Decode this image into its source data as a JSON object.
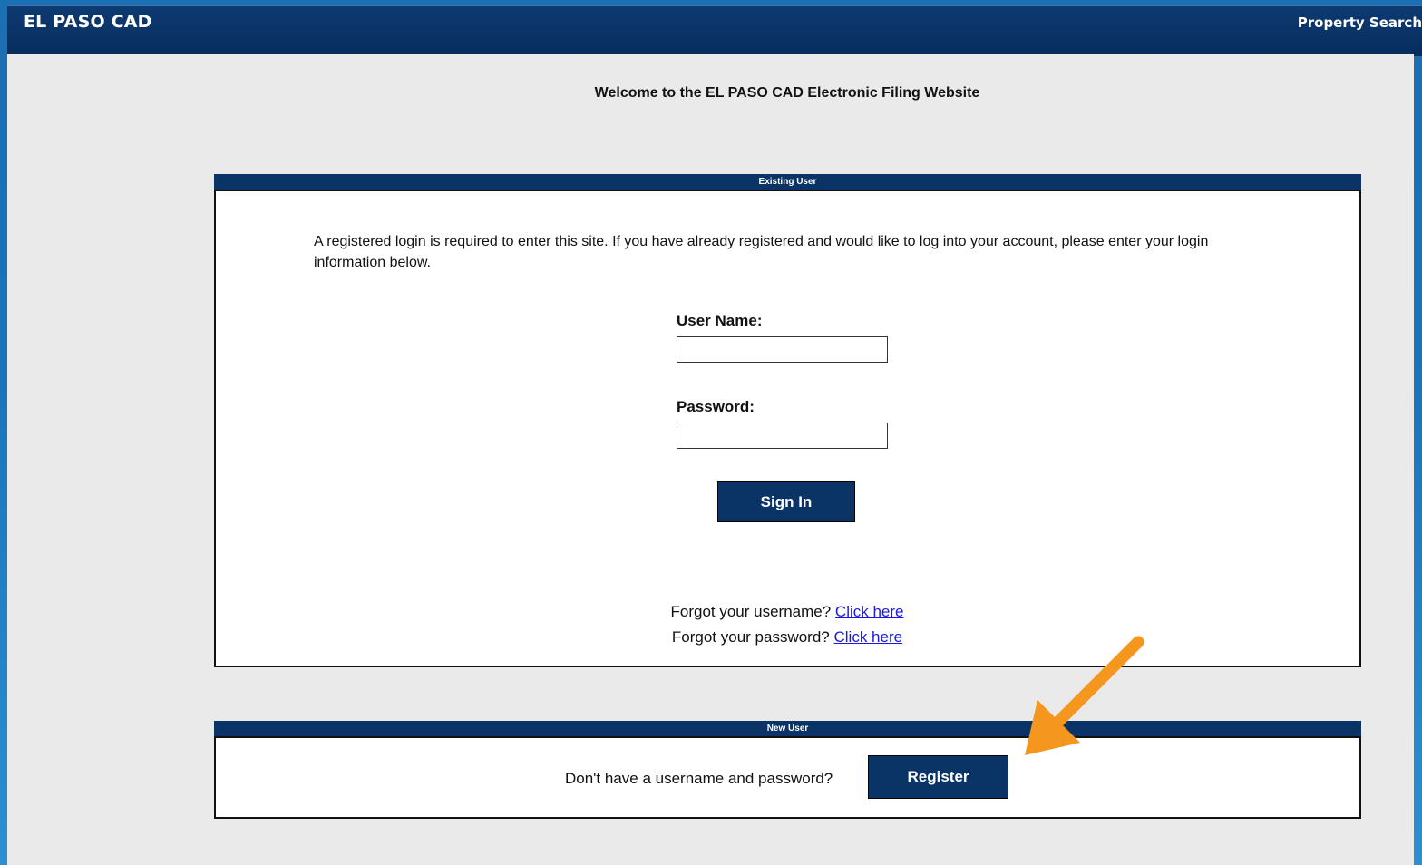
{
  "header": {
    "brand": "EL PASO CAD",
    "nav_link": "Property Search"
  },
  "welcome_text": "Welcome to the EL PASO CAD Electronic Filing Website",
  "existing_user": {
    "heading": "Existing User",
    "intro": "A registered login is required to enter this site. If you have already registered and would like to log into your account, please enter your login information below.",
    "username_label": "User Name:",
    "username_value": "",
    "password_label": "Password:",
    "password_value": "",
    "sign_in_label": "Sign In",
    "forgot_username_text": "Forgot your username?",
    "forgot_username_link": "Click here",
    "forgot_password_text": "Forgot your password?",
    "forgot_password_link": "Click here"
  },
  "new_user": {
    "heading": "New User",
    "prompt": "Don't have a username and password?",
    "register_label": "Register"
  },
  "annotation": {
    "arrow_color": "#f5961e"
  }
}
